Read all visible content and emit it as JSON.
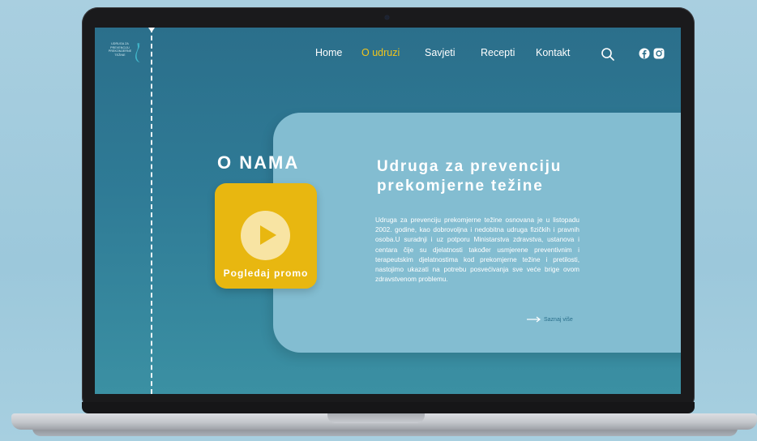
{
  "logo": {
    "lines": [
      "UDRUGA ZA",
      "PREVENCIJU",
      "PREKOMJERNE",
      "TEŽINE"
    ],
    "icon": "heron-logo-icon"
  },
  "nav": {
    "items": [
      {
        "label": "Home",
        "active": false
      },
      {
        "label": "O udruzi",
        "active": true
      },
      {
        "label": "Savjeti",
        "active": false
      },
      {
        "label": "Recepti",
        "active": false
      },
      {
        "label": "Kontakt",
        "active": false
      }
    ],
    "icons": [
      "search-icon",
      "facebook-icon",
      "instagram-icon"
    ]
  },
  "section": {
    "title": "O NAMA"
  },
  "promo": {
    "label": "Pogledaj promo",
    "icon": "play-icon"
  },
  "about": {
    "heading_line1": "Udruga za prevenciju",
    "heading_line2": "prekomjerne težine",
    "body": "Udruga za prevenciju prekomjerne težine osnovana je u listopadu 2002. godine, kao dobrovoljna i nedobitna udruga fizičkih i pravnih osoba.U suradnji i uz potporu Ministarstva zdravstva, ustanova i centara čije su djelatnosti također usmjerene preventivnim i terapeutskim djelatnostima kod prekomjerne težine i pretilosti, nastojimo ukazati na potrebu posvećivanja sve veće brige ovom zdravstvenom problemu.",
    "more_label": "Saznaj više"
  },
  "colors": {
    "accent": "#f2c51c",
    "promo_bg": "#e8b710",
    "card_bg": "#83bdd1",
    "screen_bg": "#2b6f8b"
  }
}
